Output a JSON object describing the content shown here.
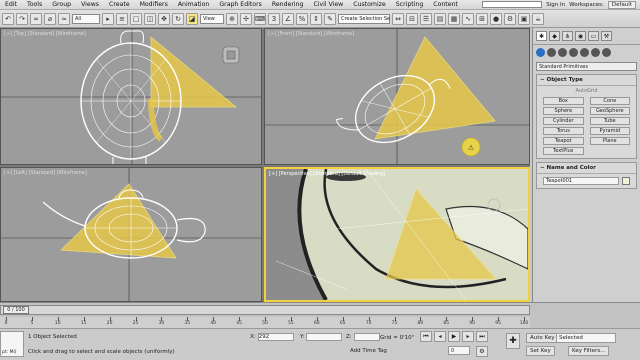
{
  "menu": {
    "items": [
      "Edit",
      "Tools",
      "Group",
      "Views",
      "Create",
      "Modifiers",
      "Animation",
      "Graph Editors",
      "Rendering",
      "Civil View",
      "Customize",
      "Scripting",
      "Content"
    ],
    "sign_in": "Sign In",
    "workspaces_label": "Workspaces:",
    "workspaces_value": "Default"
  },
  "toolbar": {
    "filter_value": "All",
    "view_value": "View",
    "selection_set_placeholder": "Create Selection Se"
  },
  "viewports": [
    {
      "label": "[+] [Top] [Standard] [Wireframe]"
    },
    {
      "label": "[+] [Front] [Standard] [Wireframe]"
    },
    {
      "label": "[+] [Left] [Standard] [Wireframe]"
    },
    {
      "label": "[+] [Perspective] [Standard] [Default Shading]"
    }
  ],
  "command_panel": {
    "dropdown": "Standard Primitives",
    "object_type_title": "Object Type",
    "autogrid": "AutoGrid",
    "buttons": [
      "Box",
      "Cone",
      "Sphere",
      "GeoSphere",
      "Cylinder",
      "Tube",
      "Torus",
      "Pyramid",
      "Teapot",
      "Plane",
      "TextPlus"
    ],
    "name_color_title": "Name and Color",
    "object_name": "Teapot001",
    "colors": {
      "wire": "#f0f5d8"
    }
  },
  "timeline": {
    "slider_text": "0 / 100",
    "ticks": [
      "0",
      "5",
      "10",
      "15",
      "20",
      "25",
      "30",
      "35",
      "40",
      "45",
      "50",
      "55",
      "60",
      "65",
      "70",
      "75",
      "80",
      "85",
      "90",
      "95",
      "100"
    ]
  },
  "status": {
    "maxscript": "pt: Mi)",
    "selected": "1 Object Selected",
    "prompt": "Click and drag to select and scale objects (uniformly)",
    "x_label": "X:",
    "x_value": "292",
    "y_label": "Y:",
    "z_label": "Z:",
    "grid": "Grid = 0'10\"",
    "add_time_tag": "Add Time Tag",
    "frame": "0",
    "auto_key": "Auto Key",
    "selected_dropdown": "Selected",
    "set_key": "Set Key",
    "key_filters": "Key Filters..."
  }
}
